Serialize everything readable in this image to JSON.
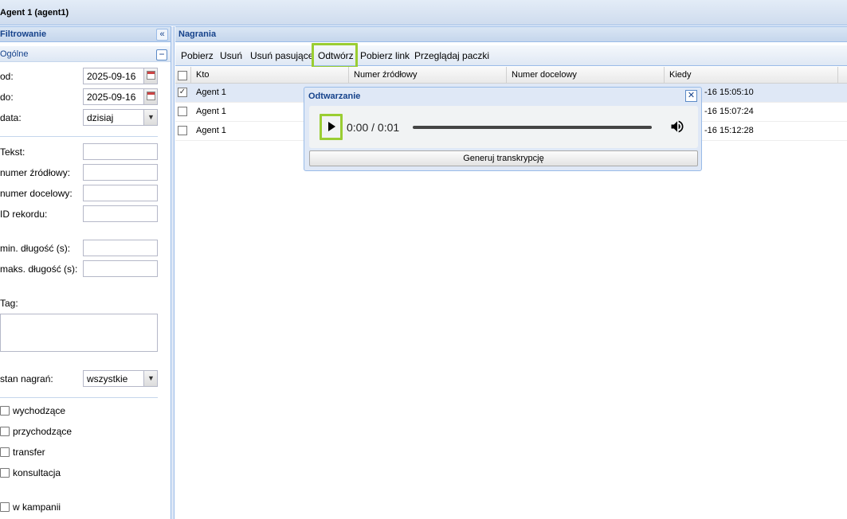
{
  "window": {
    "title": "Agent 1 (agent1)"
  },
  "filter_panel": {
    "title": "Filtrowanie",
    "section": "Ogólne",
    "fields": {
      "od_label": "od:",
      "od_value": "2025-09-16",
      "do_label": "do:",
      "do_value": "2025-09-16",
      "data_label": "data:",
      "data_value": "dzisiaj",
      "tekst_label": "Tekst:",
      "numer_zrodlowy_label": "numer źródłowy:",
      "numer_docelowy_label": "numer docelowy:",
      "id_rekordu_label": "ID rekordu:",
      "min_dlugosc_label": "min. długość (s):",
      "maks_dlugosc_label": "maks. długość (s):",
      "tag_label": "Tag:",
      "stan_label": "stan nagrań:",
      "stan_value": "wszystkie"
    },
    "checkboxes": [
      {
        "label": "wychodzące",
        "checked": false
      },
      {
        "label": "przychodzące",
        "checked": false
      },
      {
        "label": "transfer",
        "checked": false
      },
      {
        "label": "konsultacja",
        "checked": false
      },
      {
        "label": "w kampanii",
        "checked": false
      }
    ]
  },
  "recordings_panel": {
    "title": "Nagrania",
    "toolbar": {
      "pobierz": "Pobierz",
      "usun": "Usuń",
      "usun_pasujace": "Usuń pasujące",
      "odtworz": "Odtwórz",
      "pobierz_link": "Pobierz link",
      "przegladaj_paczki": "Przeglądaj paczki"
    },
    "columns": [
      "Kto",
      "Numer źródłowy",
      "Numer docelowy",
      "Kiedy"
    ],
    "rows": [
      {
        "kto": "Agent 1",
        "kiedy": "-16 15:05:10",
        "checked": true
      },
      {
        "kto": "Agent 1",
        "kiedy": "-16 15:07:24",
        "checked": false
      },
      {
        "kto": "Agent 1",
        "kiedy": "-16 15:12:28",
        "checked": false
      }
    ]
  },
  "dialog": {
    "title": "Odtwarzanie",
    "time": "0:00 / 0:01",
    "progress": 0,
    "generate_button": "Generuj transkrypcję"
  },
  "colors": {
    "accent": "#15428b",
    "highlight": "#9acd32",
    "border": "#99bbe8"
  },
  "icons": [
    "collapse-icon",
    "minus-icon",
    "calendar-icon",
    "chevron-down-icon",
    "close-icon",
    "play-icon",
    "volume-icon",
    "check-icon"
  ]
}
